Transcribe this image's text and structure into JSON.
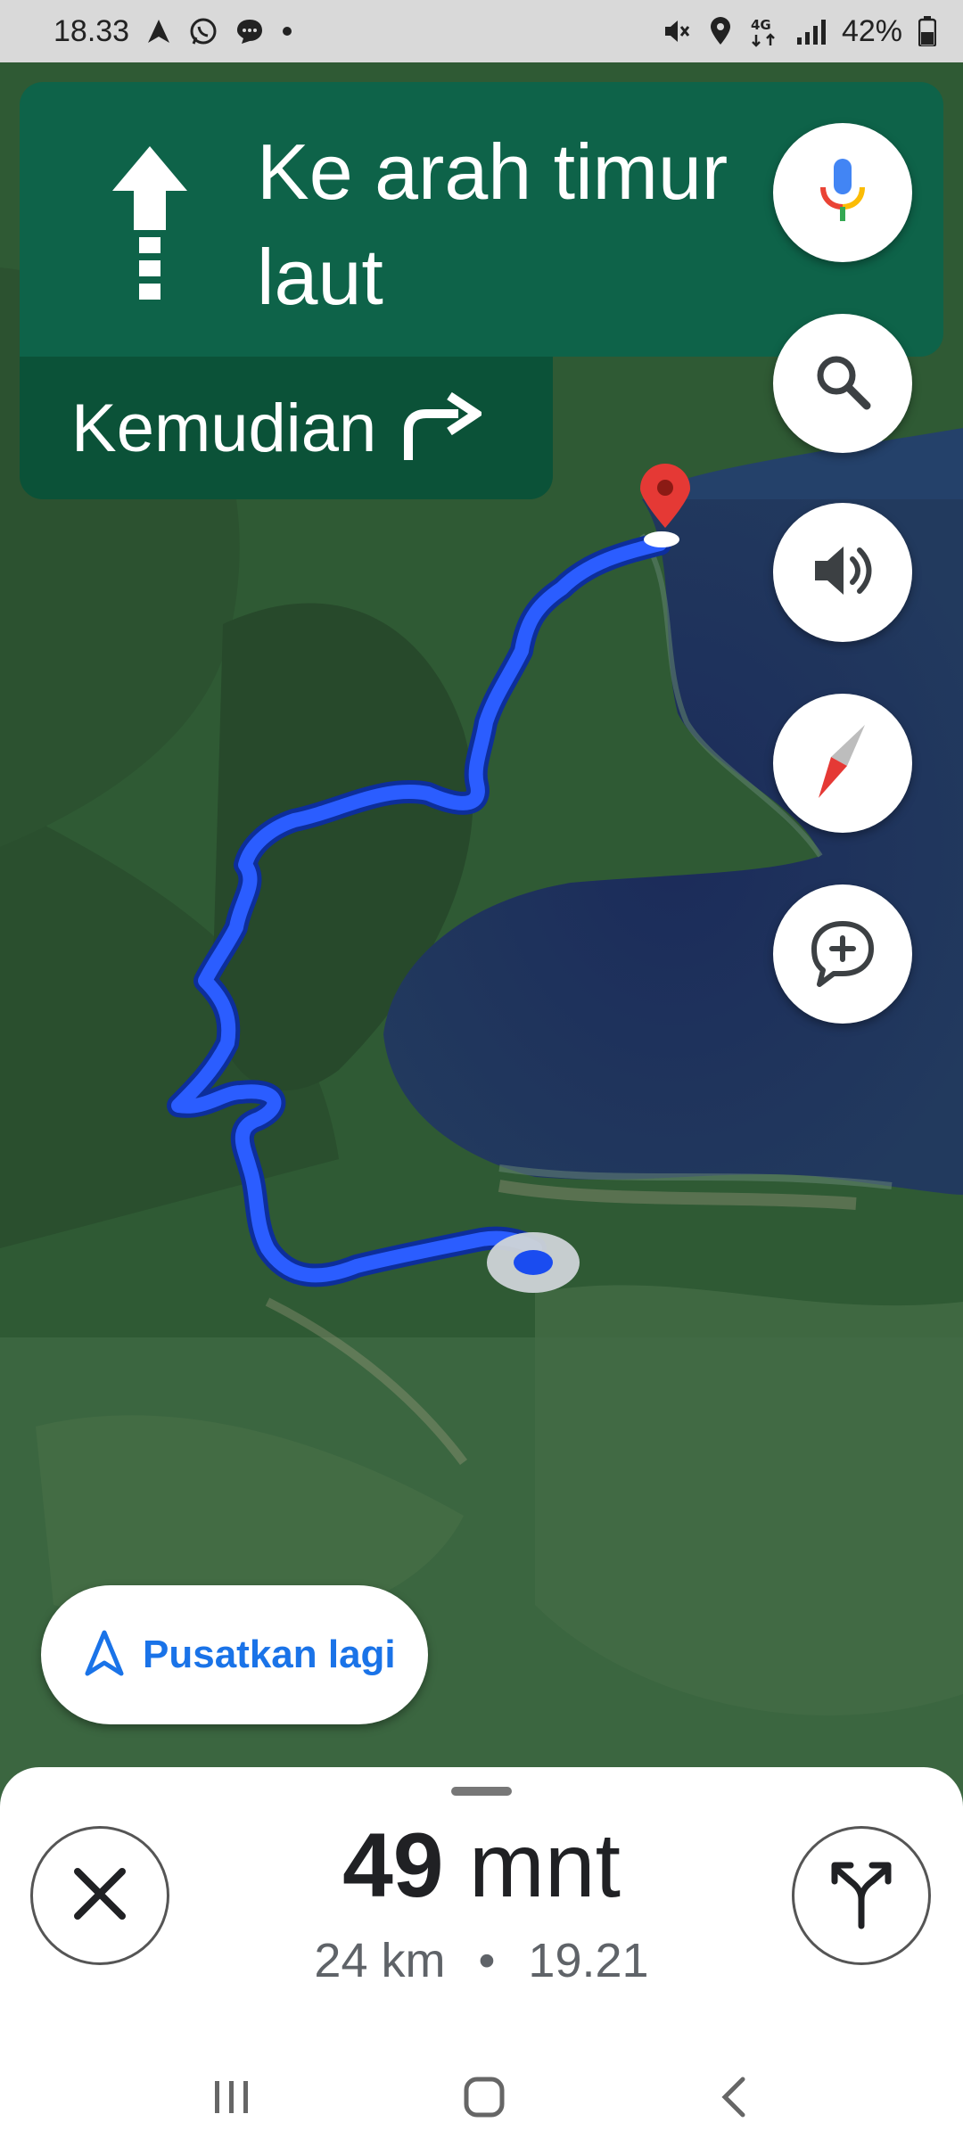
{
  "status_bar": {
    "time": "18.33",
    "notification_icons": [
      "navigation-icon",
      "whatsapp-icon",
      "message-icon",
      "dot-icon"
    ],
    "system_icons": [
      "mute-icon",
      "location-icon",
      "4g-icon",
      "signal-icon"
    ],
    "battery": "42%"
  },
  "direction": {
    "primary_text": "Ke arah timur laut",
    "maneuver_icon": "arrow-up-icon",
    "then_label": "Kemudian",
    "then_icon": "turn-right-icon"
  },
  "map_controls": [
    {
      "name": "voice-search",
      "icon": "mic-icon"
    },
    {
      "name": "search",
      "icon": "search-icon"
    },
    {
      "name": "sound",
      "icon": "volume-icon"
    },
    {
      "name": "compass",
      "icon": "compass-icon"
    },
    {
      "name": "add-report",
      "icon": "add-report-icon"
    }
  ],
  "recenter": {
    "label": "Pusatkan lagi",
    "icon": "navigation-arrow-icon"
  },
  "trip": {
    "eta_value": "49",
    "eta_unit": "mnt",
    "distance": "24 km",
    "separator": "•",
    "arrival_time": "19.21"
  },
  "colors": {
    "banner": "#0e6349",
    "banner_secondary": "#0b5238",
    "route": "#1a4cf0",
    "accent": "#1a73e8",
    "destination_pin": "#e53935"
  },
  "system_nav": [
    "recent-apps-icon",
    "home-icon",
    "back-icon"
  ]
}
